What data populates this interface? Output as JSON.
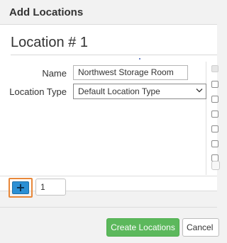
{
  "dialog": {
    "title": "Add Locations"
  },
  "location": {
    "heading": "Location # 1",
    "name_label": "Name",
    "name_value": "Northwest Storage Room",
    "type_label": "Location Type",
    "type_value": "Default Location Type"
  },
  "add_row": {
    "add_icon": "plus-icon",
    "add_symbol": "+",
    "quantity_value": "1"
  },
  "footer": {
    "create_label": "Create Locations",
    "cancel_label": "Cancel"
  },
  "colors": {
    "create_button": "#5cb85c",
    "add_button": "#2b8fd4",
    "highlight": "#e8883a"
  }
}
